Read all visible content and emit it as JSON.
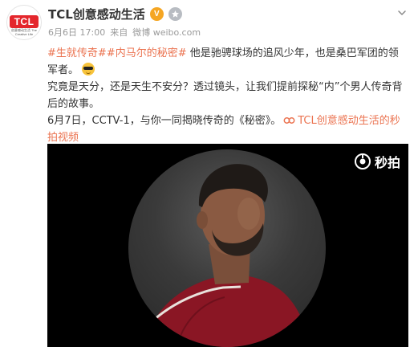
{
  "header": {
    "avatar_logo": "TCL",
    "avatar_tagline": "创意感动生活 The Creative Life",
    "name": "TCL创意感动生活",
    "verified_badge": "V",
    "meta_time": "6月6日 17:00",
    "meta_source_prefix": "来自",
    "meta_source": "微博 weibo.com"
  },
  "post": {
    "tag1": "#生就传奇#",
    "tag2": "#内马尔的秘密#",
    "line1_text": " 他是驰骋球场的追风少年，也是桑巴军团的领军者。",
    "line2_text": "究竟是天分，还是天生不安分？透过镜头，让我们提前探秘“内”个男人传奇背后的故事。",
    "line3_text": "6月7日，CCTV-1，与你一同揭晓传奇的《秘密》。",
    "video_link_label": "TCL创意感动生活的秒拍视频"
  },
  "video": {
    "brand_name": "秒拍"
  },
  "colors": {
    "link": "#eb7350",
    "text": "#333333",
    "meta": "#9a9a9a",
    "verified": "#f5a623",
    "tcl_red": "#e4262c"
  },
  "icons": {
    "verified": "verified-v-icon",
    "vip": "vip-badge-icon",
    "menu": "chevron-down-icon",
    "emoji": "emoji-sunglasses-icon",
    "video_link": "video-link-icon",
    "brand": "miaopai-logo-icon"
  }
}
